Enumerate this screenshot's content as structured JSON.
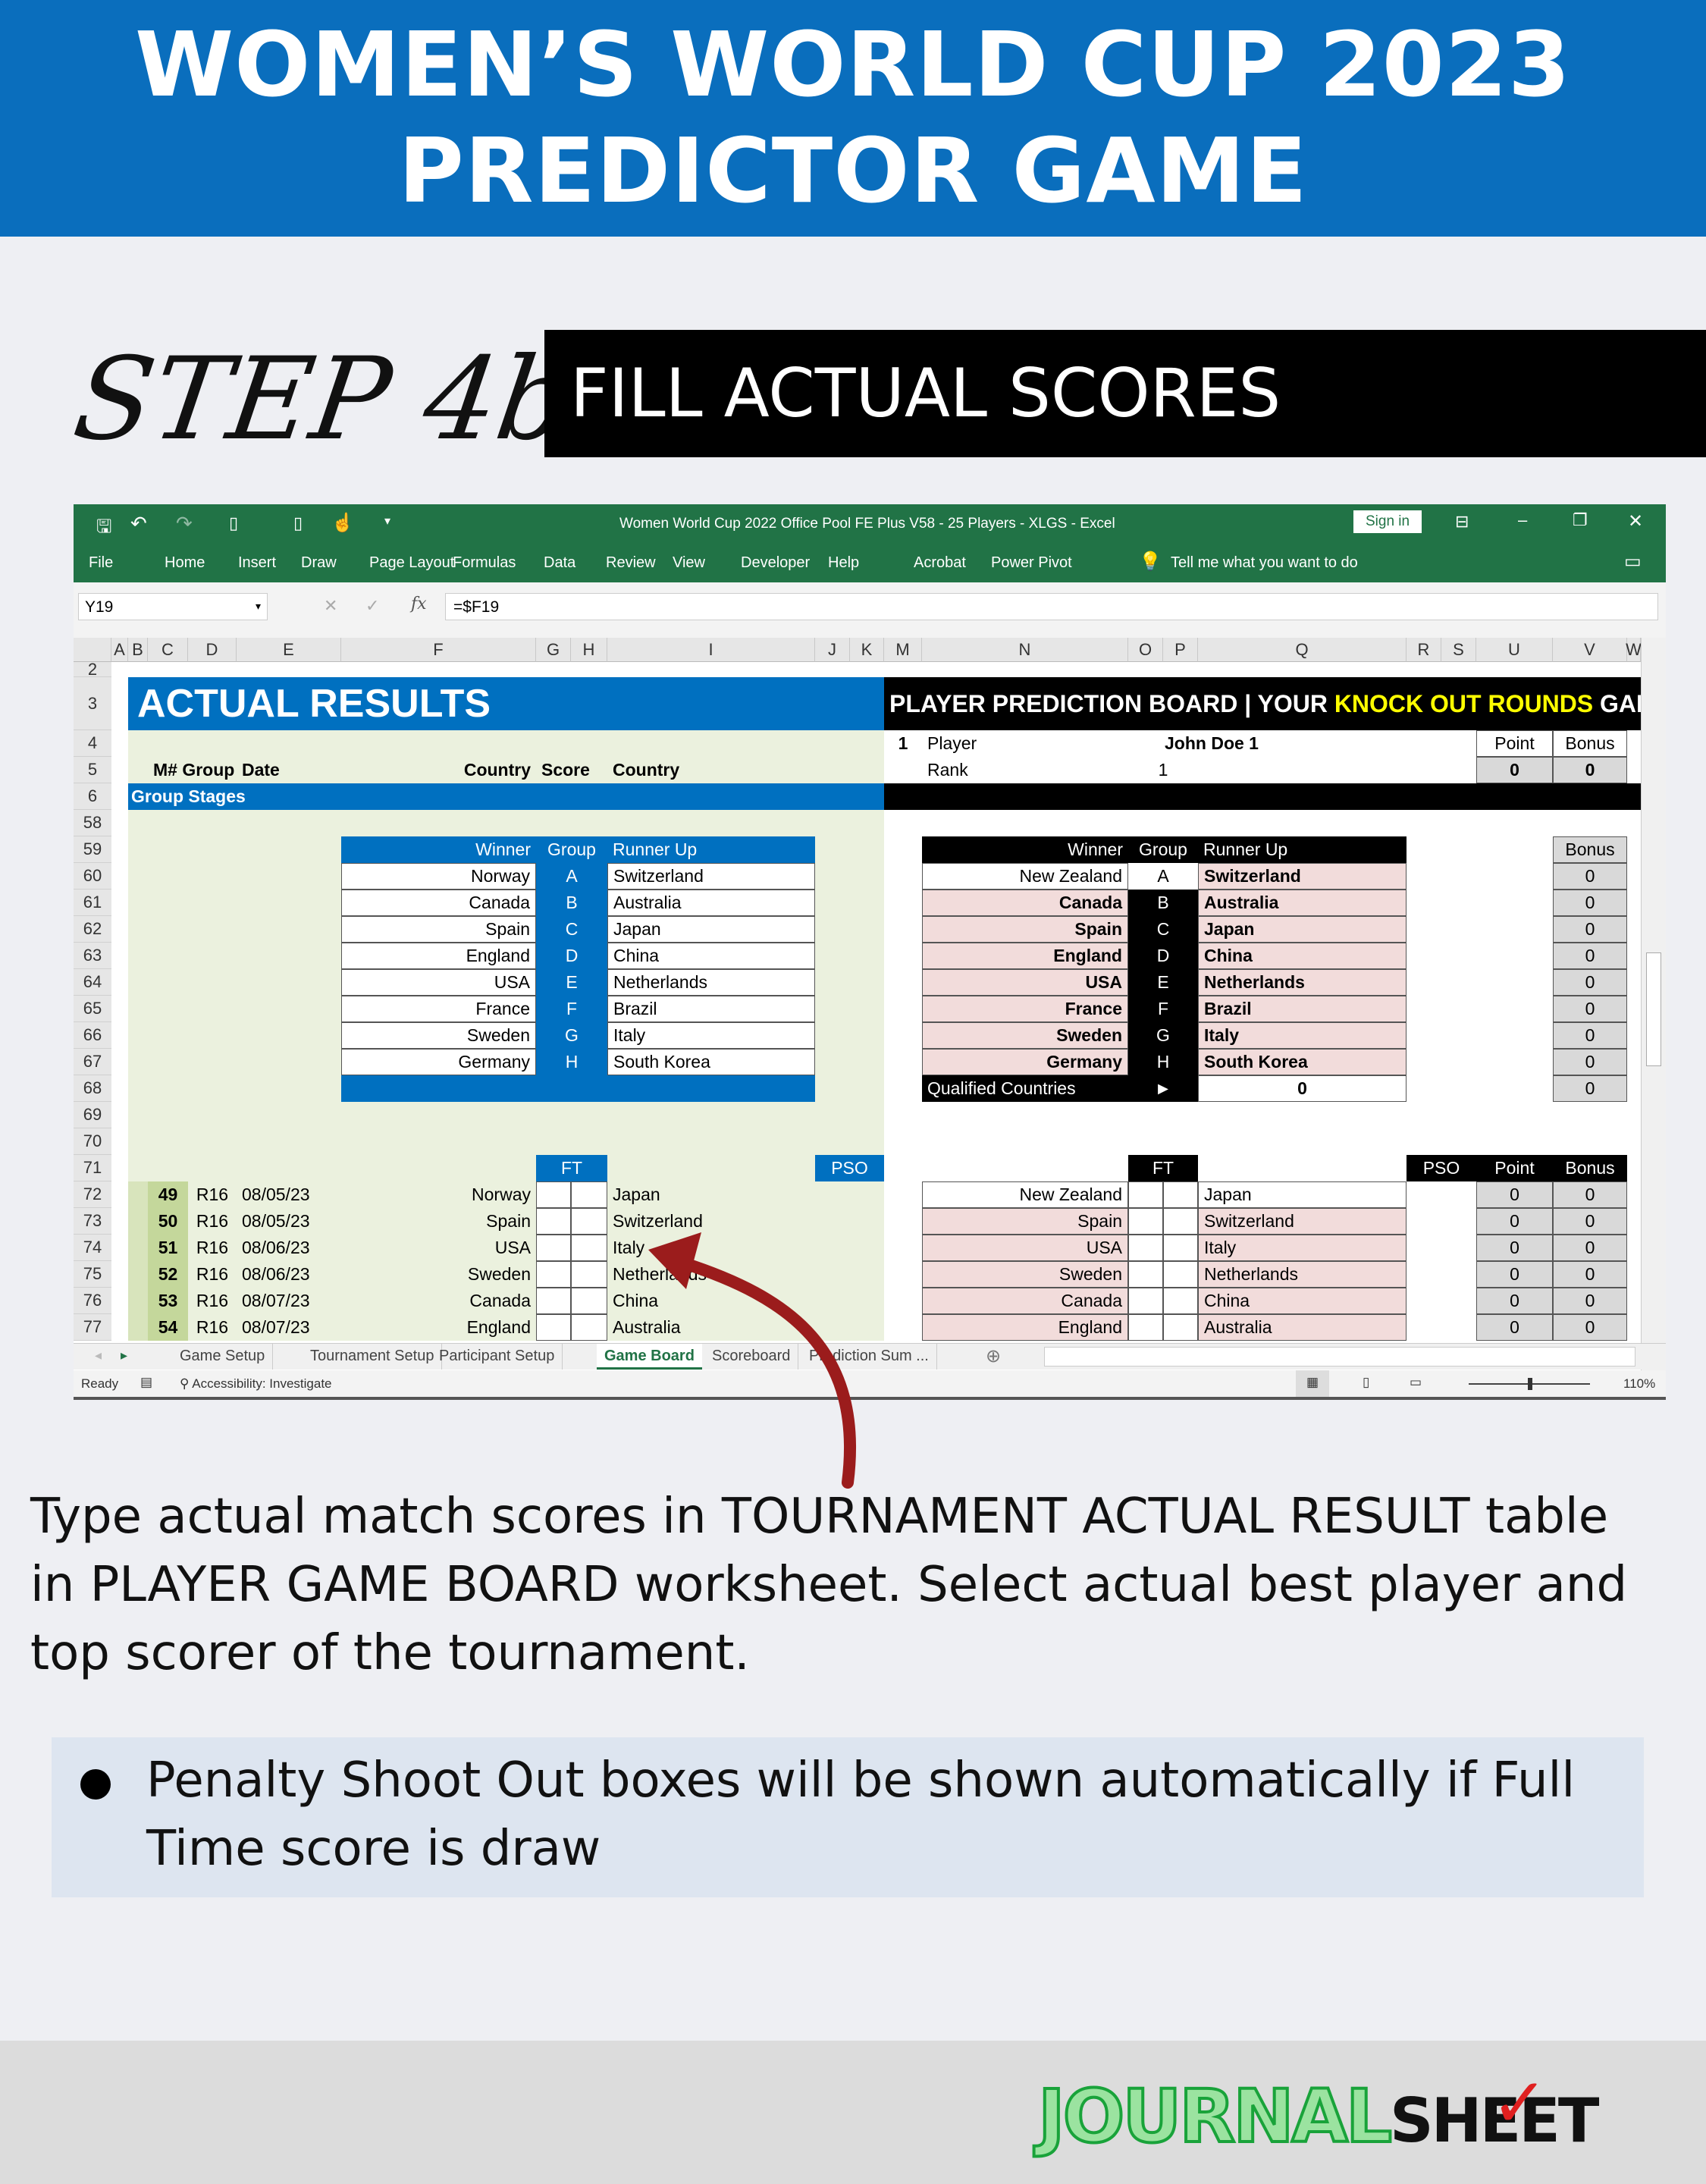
{
  "header": {
    "line1": "WOMEN’S WORLD CUP 2023",
    "line2": "PREDICTOR GAME"
  },
  "step": {
    "label": "STEP 4b",
    "title": "FILL ACTUAL SCORES"
  },
  "excel": {
    "title": "Women World Cup 2022 Office Pool FE Plus V58 - 25 Players - XLGS  -  Excel",
    "sign_in": "Sign in",
    "ribbon_tabs": [
      "File",
      "Home",
      "Insert",
      "Draw",
      "Page Layout",
      "Formulas",
      "Data",
      "Review",
      "View",
      "Developer",
      "Help",
      "Acrobat",
      "Power Pivot"
    ],
    "tell_me": "Tell me what you want to do",
    "name_box": "Y19",
    "formula": "=$F19",
    "columns": [
      "A",
      "B",
      "C",
      "D",
      "E",
      "F",
      "G",
      "H",
      "I",
      "J",
      "K",
      "M",
      "N",
      "O",
      "P",
      "Q",
      "R",
      "S",
      "U",
      "V",
      "W"
    ],
    "rows": [
      "2",
      "3",
      "4",
      "5",
      "6",
      "58",
      "59",
      "60",
      "61",
      "62",
      "63",
      "64",
      "65",
      "66",
      "67",
      "68",
      "69",
      "70",
      "71",
      "72",
      "73",
      "74",
      "75",
      "76",
      "77"
    ],
    "sheet_tabs": [
      "Game Setup",
      "Tournament Setup",
      "Participant Setup",
      "Game Board",
      "Scoreboard",
      "Prediction Sum ..."
    ],
    "active_tab": "Game Board",
    "status": {
      "ready": "Ready",
      "accessibility": "Accessibility: Investigate",
      "zoom": "110%"
    }
  },
  "actual": {
    "title": "ACTUAL RESULTS",
    "headers": {
      "mg": "M# Group",
      "date": "Date",
      "country1": "Country",
      "score": "Score",
      "country2": "Country"
    },
    "group_stages": "Group Stages",
    "group_headers": {
      "winner": "Winner",
      "group": "Group",
      "runner": "Runner Up"
    },
    "groups": [
      [
        "Norway",
        "A",
        "Switzerland"
      ],
      [
        "Canada",
        "B",
        "Australia"
      ],
      [
        "Spain",
        "C",
        "Japan"
      ],
      [
        "England",
        "D",
        "China"
      ],
      [
        "USA",
        "E",
        "Netherlands"
      ],
      [
        "France",
        "F",
        "Brazil"
      ],
      [
        "Sweden",
        "G",
        "Italy"
      ],
      [
        "Germany",
        "H",
        "South Korea"
      ]
    ],
    "ft": "FT",
    "pso": "PSO",
    "matches": [
      [
        "49",
        "R16",
        "08/05/23",
        "Norway",
        "Japan"
      ],
      [
        "50",
        "R16",
        "08/05/23",
        "Spain",
        "Switzerland"
      ],
      [
        "51",
        "R16",
        "08/06/23",
        "USA",
        "Italy"
      ],
      [
        "52",
        "R16",
        "08/06/23",
        "Sweden",
        "Netherlands"
      ],
      [
        "53",
        "R16",
        "08/07/23",
        "Canada",
        "China"
      ],
      [
        "54",
        "R16",
        "08/07/23",
        "England",
        "Australia"
      ]
    ]
  },
  "prediction": {
    "title_prefix": "PLAYER PREDICTION BOARD | YOUR ",
    "title_highlight": "KNOCK OUT ROUNDS",
    "title_suffix": " GAME S",
    "player_no": "1",
    "player_label": "Player",
    "player_name": "John Doe 1",
    "rank_label": "Rank",
    "rank": "1",
    "point_label": "Point",
    "bonus_label": "Bonus",
    "point": "0",
    "bonus": "0",
    "group_headers": {
      "winner": "Winner",
      "group": "Group",
      "runner": "Runner Up",
      "bonus": "Bonus"
    },
    "groups": [
      [
        "New Zealand",
        "A",
        "Switzerland",
        "0"
      ],
      [
        "Canada",
        "B",
        "Australia",
        "0"
      ],
      [
        "Spain",
        "C",
        "Japan",
        "0"
      ],
      [
        "England",
        "D",
        "China",
        "0"
      ],
      [
        "USA",
        "E",
        "Netherlands",
        "0"
      ],
      [
        "France",
        "F",
        "Brazil",
        "0"
      ],
      [
        "Sweden",
        "G",
        "Italy",
        "0"
      ],
      [
        "Germany",
        "H",
        "South Korea",
        "0"
      ]
    ],
    "qualified_label": "Qualified Countries",
    "qualified_arrow": "►",
    "qualified_value": "0",
    "qualified_bonus": "0",
    "ft": "FT",
    "pso": "PSO",
    "matches": [
      [
        "New Zealand",
        "Japan",
        "0",
        "0"
      ],
      [
        "Spain",
        "Switzerland",
        "0",
        "0"
      ],
      [
        "USA",
        "Italy",
        "0",
        "0"
      ],
      [
        "Sweden",
        "Netherlands",
        "0",
        "0"
      ],
      [
        "Canada",
        "China",
        "0",
        "0"
      ],
      [
        "England",
        "Australia",
        "0",
        "0"
      ]
    ]
  },
  "instructions": {
    "paragraph": "Type actual match scores in TOURNAMENT ACTUAL RESULT table in PLAYER GAME BOARD worksheet. Select actual best player and top scorer of the tournament.",
    "bullet": "Penalty Shoot Out boxes will be shown automatically if Full Time score is draw"
  },
  "logo": {
    "part1": "JOURNAL",
    "part2": "SHEET"
  },
  "colors": {
    "header_blue": "#0a6ebd",
    "excel_green": "#217346",
    "table_blue": "#0070c0",
    "pink": "#f2dcdb",
    "light_green": "#ebf1de",
    "match_no_green": "#c4d79b",
    "arrow": "#9b1c1c",
    "highlight_yellow": "#ffff00"
  }
}
